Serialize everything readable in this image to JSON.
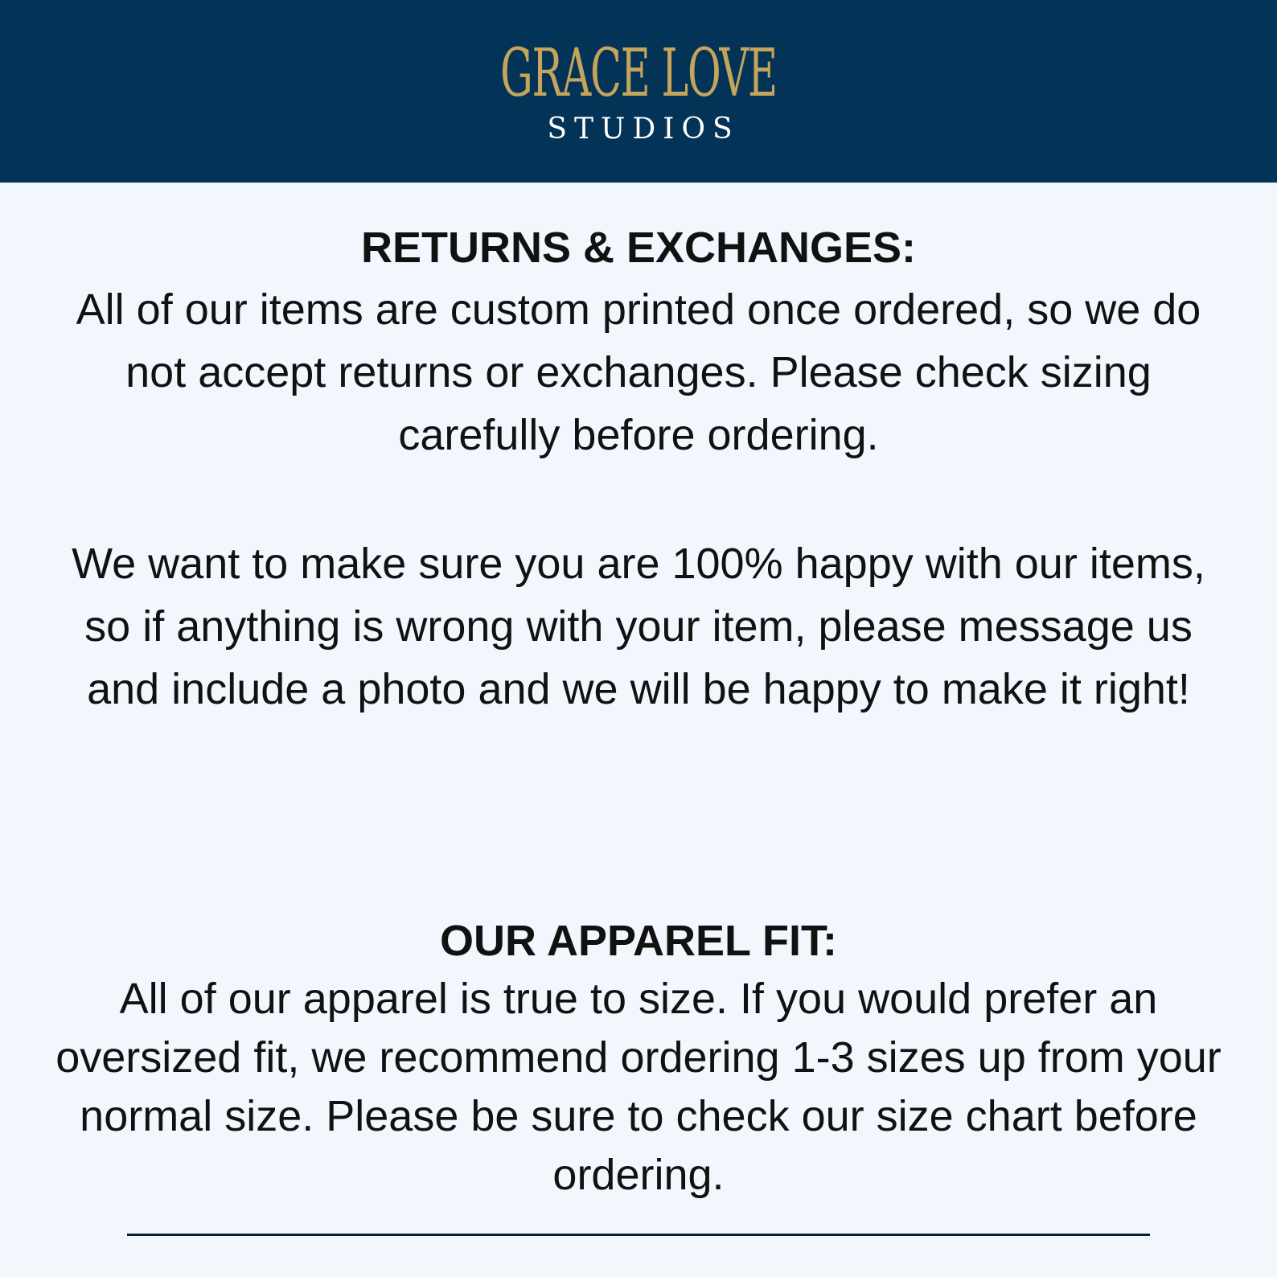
{
  "header": {
    "brand_name": "GRACE LOVE",
    "brand_sub": "STUDIOS",
    "background_color": "#033356",
    "brand_color": "#c5a45c"
  },
  "returns": {
    "heading": "RETURNS & EXCHANGES:",
    "body": "All of our items are custom printed once ordered, so we do not accept returns or exchanges. Please check sizing carefully before ordering.",
    "happiness": "We want to make sure you are 100% happy with our items, so if anything is wrong with your item, please message us and include a photo and we will be happy to make it right!"
  },
  "fit": {
    "heading": "OUR APPAREL FIT:",
    "body": "All of our apparel is true to size. If you would prefer an oversized fit, we recommend ordering 1-3 sizes up from your normal size. Please be sure to check our size chart before ordering."
  },
  "page_background": "#f1f7fd"
}
